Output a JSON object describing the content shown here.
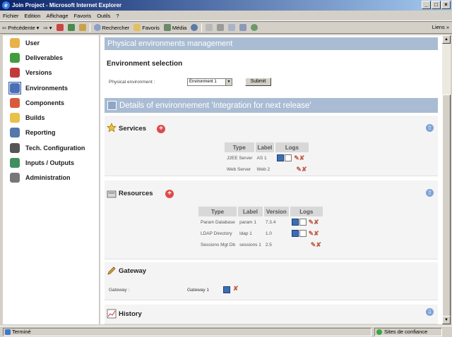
{
  "window": {
    "title": "Join Project - Microsoft Internet Explorer",
    "min": "_",
    "max": "□",
    "close": "×"
  },
  "menu": [
    "Fichier",
    "Edition",
    "Affichage",
    "Favoris",
    "Outils",
    "?"
  ],
  "toolbar": {
    "back": "Précédente",
    "search": "Rechercher",
    "favorites": "Favoris",
    "media": "Média",
    "links": "Liens"
  },
  "sidebar": [
    {
      "label": "User",
      "icon": "user-icon",
      "color": "#e8b24a"
    },
    {
      "label": "Deliverables",
      "icon": "deliverables-icon",
      "color": "#3f9d3f"
    },
    {
      "label": "Versions",
      "icon": "versions-icon",
      "color": "#c23b3b"
    },
    {
      "label": "Environments",
      "icon": "environments-icon",
      "color": "#4a6fb5",
      "active": true
    },
    {
      "label": "Components",
      "icon": "components-icon",
      "color": "#d85a3a"
    },
    {
      "label": "Builds",
      "icon": "builds-icon",
      "color": "#e9c04a"
    },
    {
      "label": "Reporting",
      "icon": "reporting-icon",
      "color": "#5577aa"
    },
    {
      "label": "Tech. Configuration",
      "icon": "tech-config-icon",
      "color": "#555555"
    },
    {
      "label": "Inputs / Outputs",
      "icon": "inputs-outputs-icon",
      "color": "#3f8f5f"
    },
    {
      "label": "Administration",
      "icon": "administration-icon",
      "color": "#777777"
    }
  ],
  "main": {
    "header": "Physical environments management",
    "selection_title": "Environment selection",
    "env_label": "Physical environment :",
    "env_value": "Environment 1",
    "submit": "Submit",
    "details": "Details of environnement 'Integration for next release'",
    "services": {
      "title": "Services",
      "headers": [
        "Type",
        "Label",
        "Logs"
      ],
      "rows": [
        {
          "type": "J2EE Server",
          "label": "AS 1"
        },
        {
          "type": "Web Server",
          "label": "Web 2"
        }
      ]
    },
    "resources": {
      "title": "Resources",
      "headers": [
        "Type",
        "Label",
        "Version",
        "Logs"
      ],
      "rows": [
        {
          "type": "Param Database",
          "label": "param 1",
          "version": "7.3.4"
        },
        {
          "type": "LDAP Directory",
          "label": "ldap 1",
          "version": "1.0"
        },
        {
          "type": "Sessions Mgt Db",
          "label": "sessions 1",
          "version": "2.5"
        }
      ]
    },
    "gateway": {
      "title": "Gateway",
      "label": "Gateway :",
      "value": "Gateway 1"
    },
    "history": {
      "title": "History"
    }
  },
  "status": {
    "text": "Terminé",
    "zone": "Sites de confiance"
  }
}
